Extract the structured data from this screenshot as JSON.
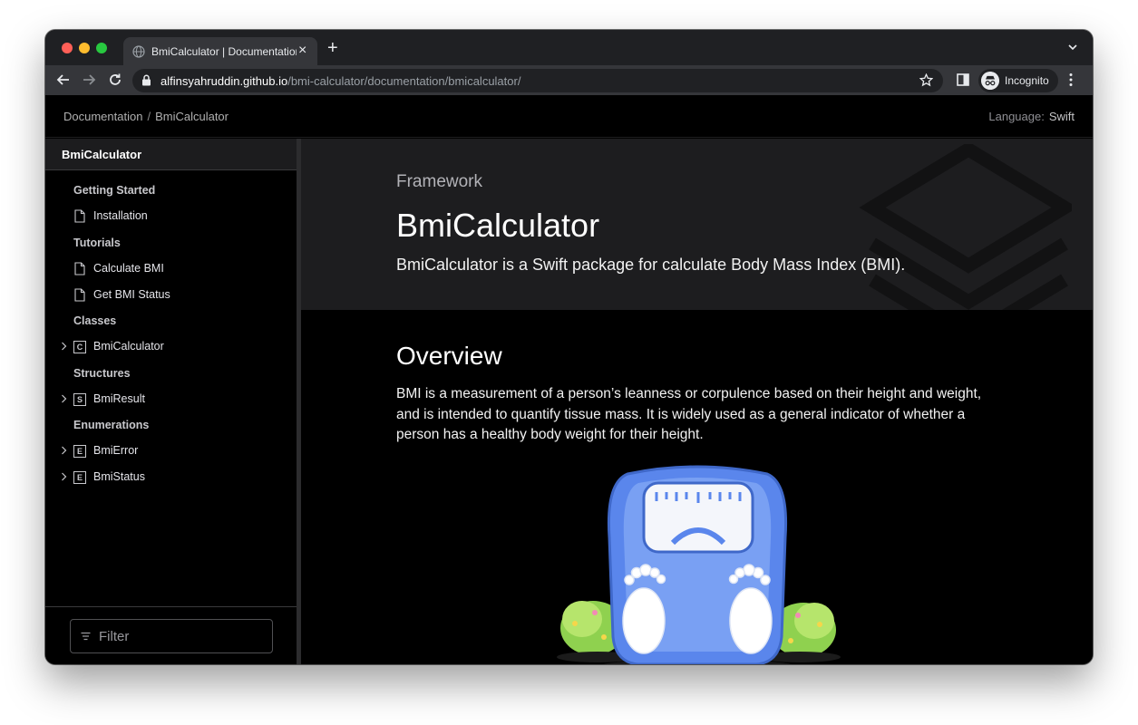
{
  "browser": {
    "tab": {
      "title": "BmiCalculator | Documentation",
      "close_glyph": "×"
    },
    "new_tab_glyph": "+",
    "address": {
      "host": "alfinsyahruddin.github.io",
      "path": "/bmi-calculator/documentation/bmicalculator/"
    },
    "profile_label": "Incognito"
  },
  "doc_header": {
    "breadcrumbs": [
      "Documentation",
      "BmiCalculator"
    ],
    "breadcrumb_separator": "/",
    "language_label": "Language:",
    "language_value": "Swift"
  },
  "sidebar": {
    "title": "BmiCalculator",
    "items": [
      {
        "type": "section",
        "label": "Getting Started"
      },
      {
        "type": "article",
        "label": "Installation"
      },
      {
        "type": "section",
        "label": "Tutorials"
      },
      {
        "type": "article",
        "label": "Calculate BMI"
      },
      {
        "type": "article",
        "label": "Get BMI Status"
      },
      {
        "type": "section",
        "label": "Classes"
      },
      {
        "type": "symbol",
        "badge": "C",
        "label": "BmiCalculator"
      },
      {
        "type": "section",
        "label": "Structures"
      },
      {
        "type": "symbol",
        "badge": "S",
        "label": "BmiResult"
      },
      {
        "type": "section",
        "label": "Enumerations"
      },
      {
        "type": "symbol",
        "badge": "E",
        "label": "BmiError"
      },
      {
        "type": "symbol",
        "badge": "E",
        "label": "BmiStatus"
      }
    ],
    "filter_placeholder": "Filter"
  },
  "main": {
    "eyebrow": "Framework",
    "title": "BmiCalculator",
    "abstract": "BmiCalculator is a Swift package for calculate Body Mass Index (BMI).",
    "overview_heading": "Overview",
    "overview_text": "BMI is a measurement of a person’s leanness or corpulence based on their height and weight, and is intended to quantify tissue mass. It is widely used as a general indicator of whether a person has a healthy body weight for their height.",
    "illustration_icon": "bathroom-scale-illustration"
  },
  "colors": {
    "page_background": "#000000",
    "hero_background": "#1d1d1f",
    "scale_blue": "#5a86ec",
    "grass_green": "#8fd14f"
  }
}
